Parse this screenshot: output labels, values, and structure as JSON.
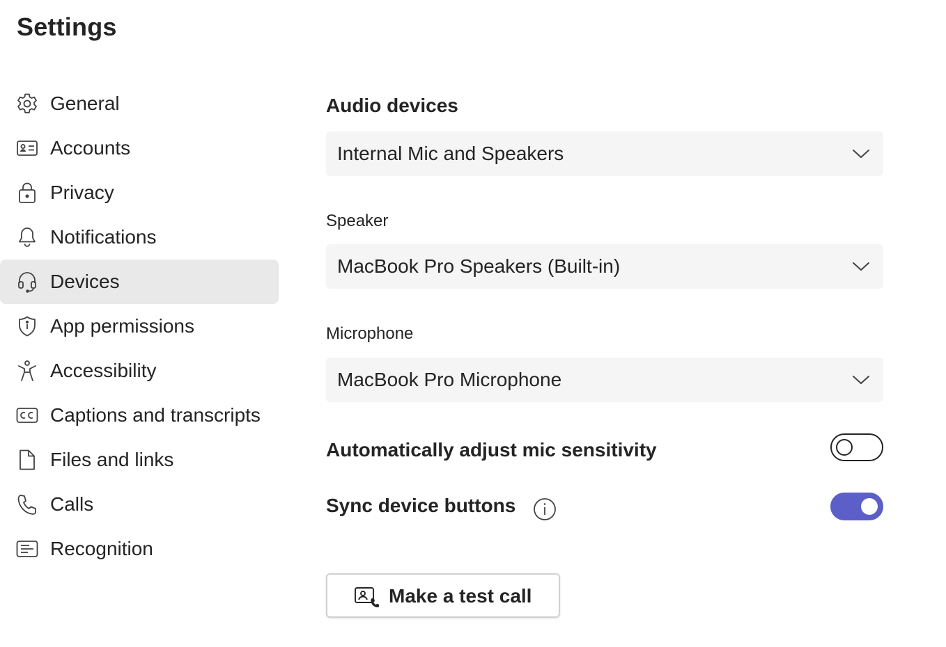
{
  "page": {
    "title": "Settings"
  },
  "sidebar": {
    "items": [
      {
        "label": "General",
        "icon": "gear-icon",
        "selected": false
      },
      {
        "label": "Accounts",
        "icon": "id-card-icon",
        "selected": false
      },
      {
        "label": "Privacy",
        "icon": "lock-icon",
        "selected": false
      },
      {
        "label": "Notifications",
        "icon": "bell-icon",
        "selected": false
      },
      {
        "label": "Devices",
        "icon": "headset-icon",
        "selected": true
      },
      {
        "label": "App permissions",
        "icon": "shield-icon",
        "selected": false
      },
      {
        "label": "Accessibility",
        "icon": "accessibility-icon",
        "selected": false
      },
      {
        "label": "Captions and transcripts",
        "icon": "cc-icon",
        "selected": false
      },
      {
        "label": "Files and links",
        "icon": "file-icon",
        "selected": false
      },
      {
        "label": "Calls",
        "icon": "phone-icon",
        "selected": false
      },
      {
        "label": "Recognition",
        "icon": "recognition-icon",
        "selected": false
      }
    ]
  },
  "main": {
    "audio_devices": {
      "title": "Audio devices",
      "value": "Internal Mic and Speakers"
    },
    "speaker": {
      "label": "Speaker",
      "value": "MacBook Pro Speakers (Built-in)"
    },
    "microphone": {
      "label": "Microphone",
      "value": "MacBook Pro Microphone"
    },
    "auto_mic": {
      "label": "Automatically adjust mic sensitivity",
      "enabled": false
    },
    "sync_buttons": {
      "label": "Sync device buttons",
      "enabled": true
    },
    "test_call": {
      "label": "Make a test call"
    }
  },
  "colors": {
    "accent": "#5b5fc7",
    "selected_bg": "#e9e9e9",
    "dropdown_bg": "#f5f5f5",
    "text": "#242424"
  }
}
